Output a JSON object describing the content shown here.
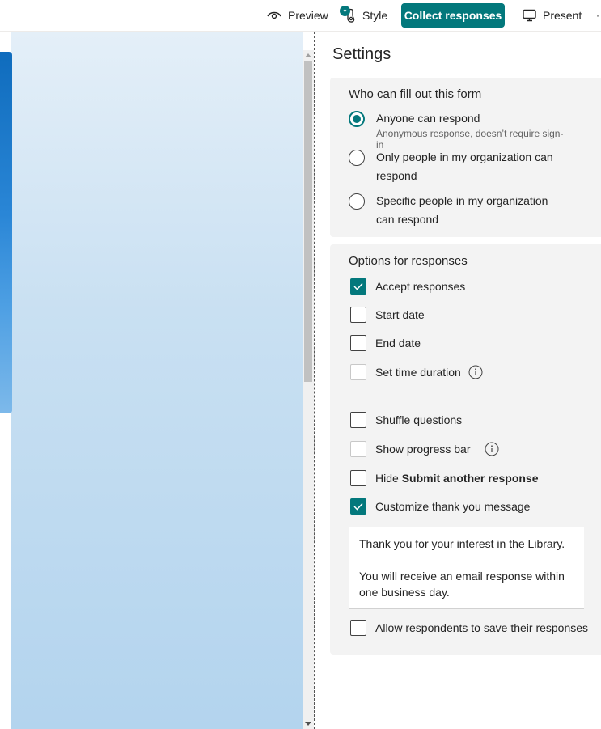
{
  "toolbar": {
    "preview_label": "Preview",
    "style_label": "Style",
    "collect_label": "Collect responses",
    "present_label": "Present",
    "accent": "#03787c"
  },
  "settings": {
    "title": "Settings",
    "who_title": "Who can fill out this form",
    "radio_options": [
      {
        "label": "Anyone can respond",
        "sub": "Anonymous response, doesn’t require sign-in",
        "checked": true
      },
      {
        "label": "Only people in my organization can respond",
        "checked": false
      },
      {
        "label": "Specific people in my organization can respond",
        "checked": false
      }
    ],
    "options_title": "Options for responses",
    "checkboxes": {
      "accept": {
        "label": "Accept responses",
        "checked": true
      },
      "start_date": {
        "label": "Start date",
        "checked": false
      },
      "end_date": {
        "label": "End date",
        "checked": false
      },
      "time_duration": {
        "label": "Set time duration",
        "checked": false,
        "disabled": true
      },
      "shuffle": {
        "label": "Shuffle questions",
        "checked": false
      },
      "progress_bar": {
        "label": "Show progress bar",
        "checked": false,
        "disabled": true
      },
      "hide_submit_prefix": "Hide",
      "hide_submit_bold": "Submit another response",
      "customize_thanks": {
        "label": "Customize thank you message",
        "checked": true
      },
      "save_responses": {
        "label": "Allow respondents to save their responses",
        "checked": false
      }
    },
    "thank_you_message": {
      "line1": "Thank you for your interest in the Library.",
      "line2": "You will receive an email response within one business day."
    }
  },
  "icons": [
    "eye-icon",
    "palette-icon",
    "monitor-icon",
    "info-icon",
    "checkmark-icon"
  ]
}
